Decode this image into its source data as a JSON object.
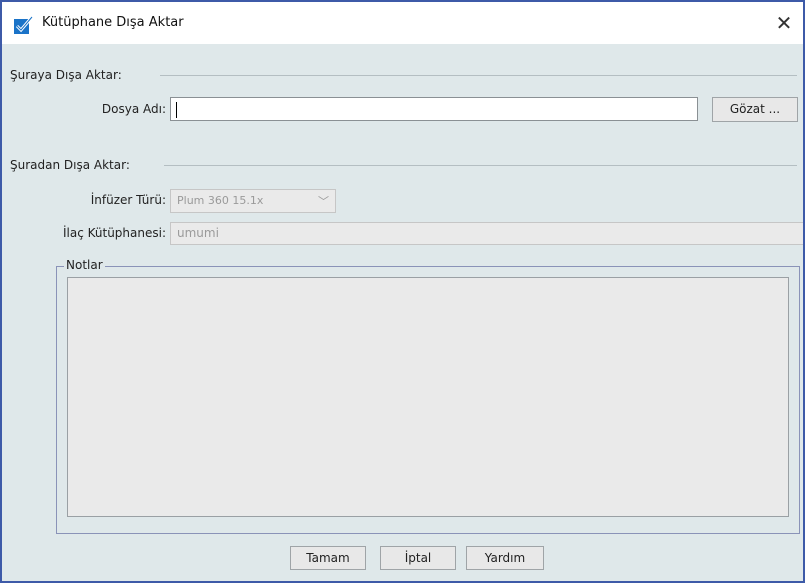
{
  "window": {
    "title": "Kütüphane Dışa Aktar",
    "close_icon": "close-icon",
    "title_icon": "checkbox-check-icon"
  },
  "export_to": {
    "section_label": "Şuraya Dışa Aktar:",
    "file_name_label": "Dosya Adı:",
    "file_name_value": "",
    "browse_label": "Gözat ..."
  },
  "export_from": {
    "section_label": "Şuradan Dışa Aktar:",
    "infuser_type_label": "İnfüzer Türü:",
    "infuser_type_value": "Plum 360 15.1x",
    "drug_library_label": "İlaç Kütüphanesi:",
    "drug_library_value": "umumi"
  },
  "notes": {
    "label": "Notlar",
    "value": ""
  },
  "buttons": {
    "ok": "Tamam",
    "cancel": "İptal",
    "help": "Yardım"
  }
}
